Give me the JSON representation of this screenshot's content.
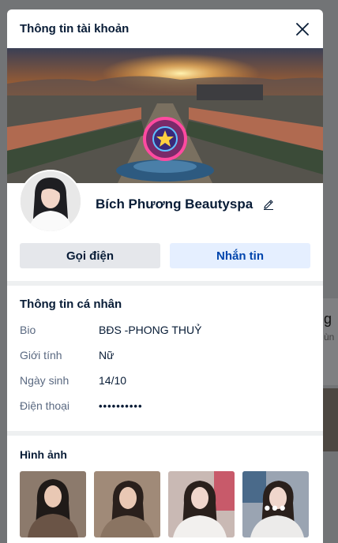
{
  "modal": {
    "title": "Thông tin tài khoản"
  },
  "profile": {
    "name": "Bích Phương Beautyspa"
  },
  "actions": {
    "call_label": "Gọi điện",
    "message_label": "Nhắn tin"
  },
  "personal_info": {
    "title": "Thông tin cá nhân",
    "rows": [
      {
        "label": "Bio",
        "value": "BĐS -PHONG THUỶ"
      },
      {
        "label": "Giới tính",
        "value": "Nữ"
      },
      {
        "label": "Ngày sinh",
        "value": "14/10"
      },
      {
        "label": "Điện thoại",
        "value": "••••••••••"
      }
    ]
  },
  "photos": {
    "title": "Hình ảnh",
    "more_indicator": "•••"
  },
  "background": {
    "partial_heading": "g",
    "partial_sub": "ùn"
  },
  "colors": {
    "primary": "#0045ad",
    "primary_bg": "#e5efff",
    "text": "#081c36",
    "muted": "#5a6981"
  }
}
